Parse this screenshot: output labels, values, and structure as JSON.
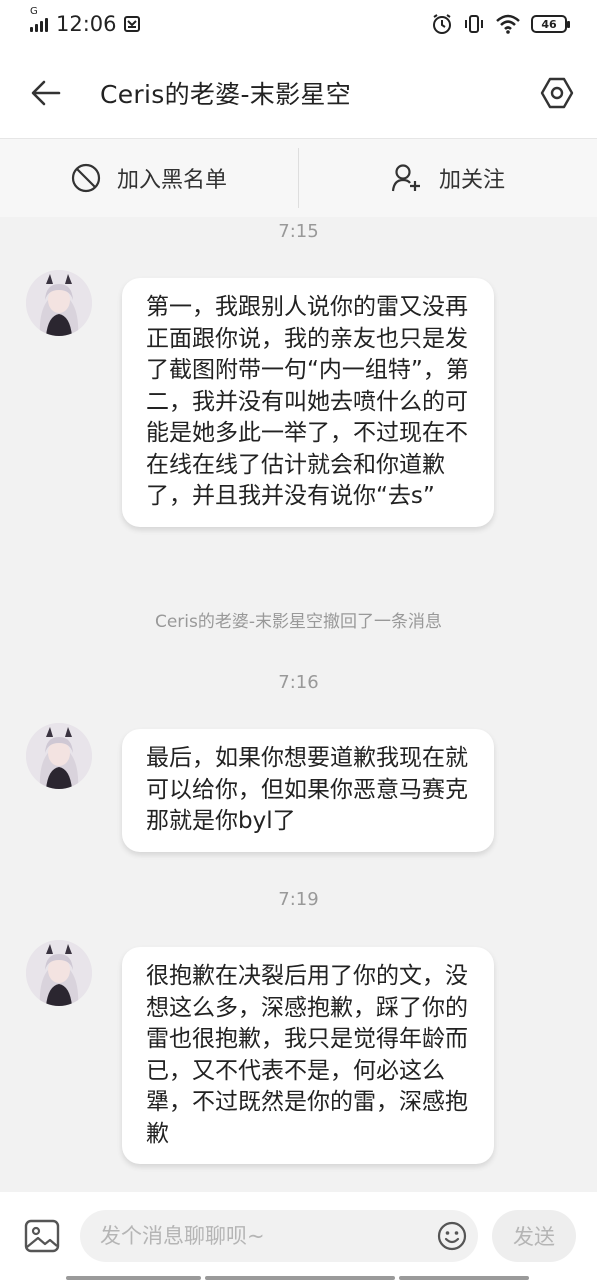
{
  "status_bar": {
    "time": "12:06",
    "sim_label": "G",
    "battery": "46"
  },
  "header": {
    "title": "Ceris的老婆-末影星空"
  },
  "actions": {
    "block_label": "加入黑名单",
    "follow_label": "加关注"
  },
  "messages": [
    {
      "time": "7:15",
      "text": "第一，我跟别人说你的雷又没再正面跟你说，我的亲友也只是发了截图附带一句“内一组特”，第二，我并没有叫她去喷什么的可能是她多此一举了，不过现在不在线在线了估计就会和你道歉了，并且我并没有说你“去s”"
    },
    {
      "time": "7:16",
      "text": "最后，如果你想要道歉我现在就可以给你，但如果你恶意马赛克那就是你byl了"
    },
    {
      "time": "7:19",
      "text": "很抱歉在决裂后用了你的文，没想这么多，深感抱歉，踩了你的雷也很抱歉，我只是觉得年龄而已，又不代表不是，何必这么犟，不过既然是你的雷，深感抱歉"
    }
  ],
  "recall_notice": "Ceris的老婆-末影星空撤回了一条消息",
  "input_bar": {
    "placeholder": "发个消息聊聊呗~",
    "value": "",
    "send_label": "发送"
  },
  "icons": {
    "back": "back-arrow-icon",
    "settings": "hexagon-settings-icon",
    "block": "block-icon",
    "follow": "add-user-icon",
    "image": "image-icon",
    "emoji": "emoji-icon"
  },
  "colors": {
    "background": "#f2f2f2",
    "bubble": "#ffffff",
    "muted_text": "#999999",
    "placeholder": "#b5b5b5"
  }
}
